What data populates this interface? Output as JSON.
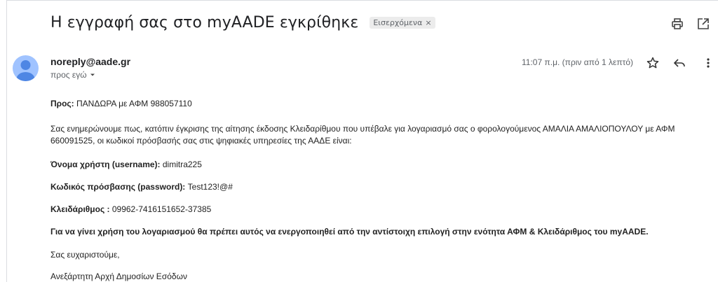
{
  "subject": "Η εγγραφή σας στο myAADE εγκρίθηκε",
  "label": "Εισερχόμενα",
  "label_remove": "×",
  "icons": {
    "print": "printer-icon",
    "popout": "open-in-new-window-icon",
    "star": "star-icon",
    "reply": "reply-icon",
    "more": "more-vert-icon"
  },
  "sender": {
    "email": "noreply@aade.gr",
    "recipient_label": "προς εγώ",
    "time": "11:07 π.μ. (πριν από 1 λεπτό)"
  },
  "body": {
    "to_label": "Προς:",
    "to_value": " ΠΑΝΔΩΡΑ με ΑΦΜ 988057110",
    "intro": "Σας ενημερώνουμε πως, κατόπιν έγκρισης της αίτησης έκδοσης Κλειδαρίθμου που υπέβαλε για λογαριασμό σας ο φορολογούμενος ΑΜΑΛΙΑ ΑΜΑΛΙΟΠΟΥΛΟΥ με ΑΦΜ 660091525, οι κωδικοί πρόσβασής σας στις ψηφιακές υπηρεσίες της ΑΑΔΕ είναι:",
    "username_label": "Όνομα χρήστη (username):",
    "username_value": " dimitra225",
    "password_label": "Κωδικός πρόσβασης (password):",
    "password_value": " Test123!@#",
    "keycode_label": "Κλειδάριθμος :",
    "keycode_value": " 09962-7416151652-37385",
    "activation_note": "Για να γίνει χρήση του λογαριασμού θα πρέπει αυτός να ενεργοποιηθεί από την αντίστοιχη επιλογή στην ενότητα ΑΦΜ & Κλειδάριθμος του myAADE.",
    "thanks": "Σας ευχαριστούμε,",
    "signature": "Ανεξάρτητη Αρχή Δημοσίων Εσόδων"
  },
  "colors": {
    "avatar_bg": "#a0c3ff",
    "avatar_fg": "#4e86e4",
    "text": "#222222",
    "muted": "#5f6368"
  }
}
